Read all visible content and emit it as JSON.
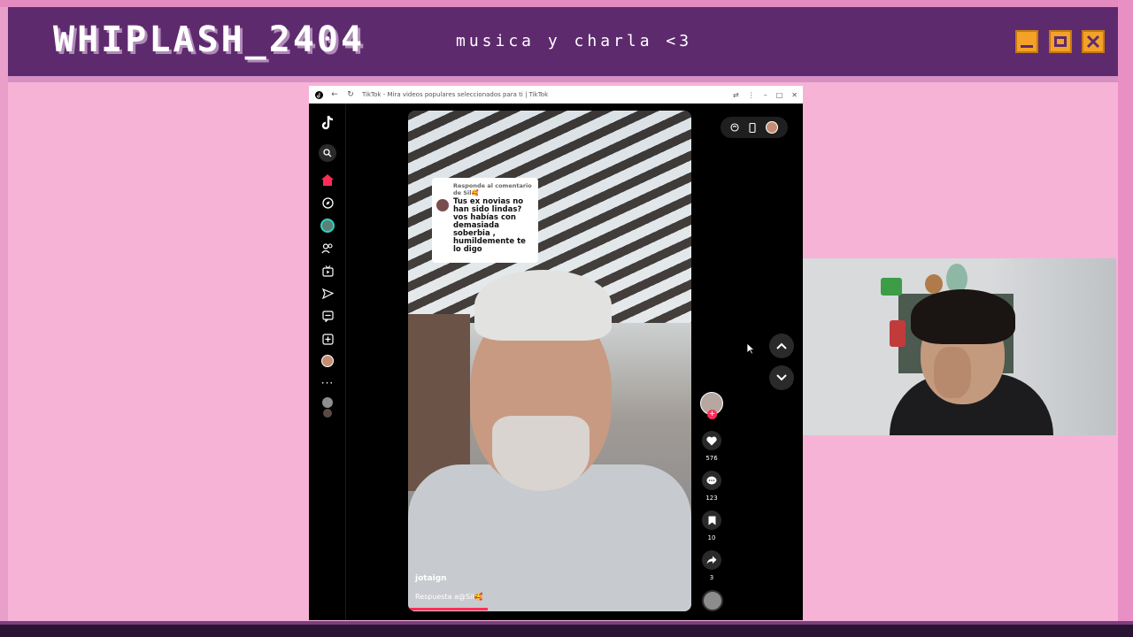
{
  "overlay": {
    "logo": "WHIPLASH_2404",
    "subtitle": "musica y charla <3",
    "accent": "#5e2a6e",
    "background": "#f7b3d6",
    "button_color": "#f3a227"
  },
  "browser": {
    "tab_title": "TikTok - Mira videos populares seleccionados para ti | TikTok",
    "window_controls": [
      "minimize-icon",
      "maximize-icon",
      "close-icon"
    ]
  },
  "sidebar": {
    "icons": [
      "tiktok-logo-icon",
      "search-icon",
      "home-icon",
      "explore-icon",
      "live-avatar",
      "following-icon",
      "live-icon",
      "messages-icon",
      "inbox-icon",
      "upload-icon",
      "profile-avatar",
      "more-icon"
    ]
  },
  "video": {
    "comment_reply": {
      "header": "Responde al comentario de Sil🥰",
      "text": "Tus ex novias no han sido lindas? vos habías con demasiada soberbia , humildemente te lo digo"
    },
    "author": "jotaign",
    "caption": "Respuesta a@Sil🥰",
    "progress_fraction": 0.28
  },
  "actions": {
    "likes": "576",
    "comments": "123",
    "saves": "10",
    "shares": "3"
  }
}
